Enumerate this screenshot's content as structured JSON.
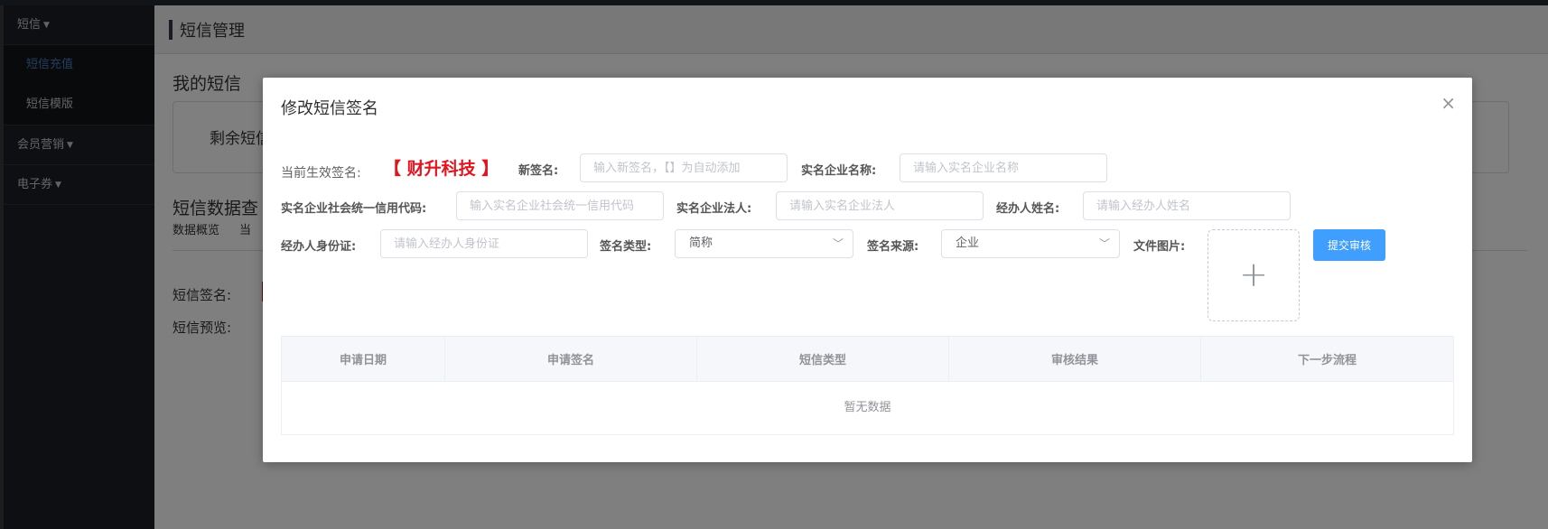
{
  "sidebar": {
    "groups": [
      {
        "label": "短信",
        "items": [
          "短信充值",
          "短信模版"
        ]
      },
      {
        "label": "会员营销"
      },
      {
        "label": "电子券"
      }
    ]
  },
  "background": {
    "breadcrumb": "短信管理",
    "my_sms_title": "我的短信",
    "remaining_label": "剩余短信",
    "query_title": "短信数据查",
    "tabs": [
      "数据概览",
      "当"
    ],
    "sign_label": "短信签名:",
    "preview_label": "短信预览:"
  },
  "dialog": {
    "title": "修改短信签名",
    "close": "×",
    "current_sign_label": "当前生效签名:",
    "current_sign_value": "【 财升科技 】",
    "new_sign_label": "新签名:",
    "new_sign_placeholder": "输入新签名，【】为自动添加",
    "company_name_label": "实名企业名称:",
    "company_name_placeholder": "请输入实名企业名称",
    "credit_code_label": "实名企业社会统一信用代码:",
    "credit_code_placeholder": "输入实名企业社会统一信用代码",
    "legal_person_label": "实名企业法人:",
    "legal_person_placeholder": "请输入实名企业法人",
    "agent_name_label": "经办人姓名:",
    "agent_name_placeholder": "请输入经办人姓名",
    "agent_id_label": "经办人身份证:",
    "agent_id_placeholder": "请输入经办人身份证",
    "sign_type_label": "签名类型:",
    "sign_type_value": "简称",
    "sign_source_label": "签名来源:",
    "sign_source_value": "企业",
    "file_label": "文件图片:",
    "submit_label": "提交审核",
    "table": {
      "columns": [
        "申请日期",
        "申请签名",
        "短信类型",
        "审核结果",
        "下一步流程"
      ],
      "empty_text": "暂无数据"
    }
  }
}
